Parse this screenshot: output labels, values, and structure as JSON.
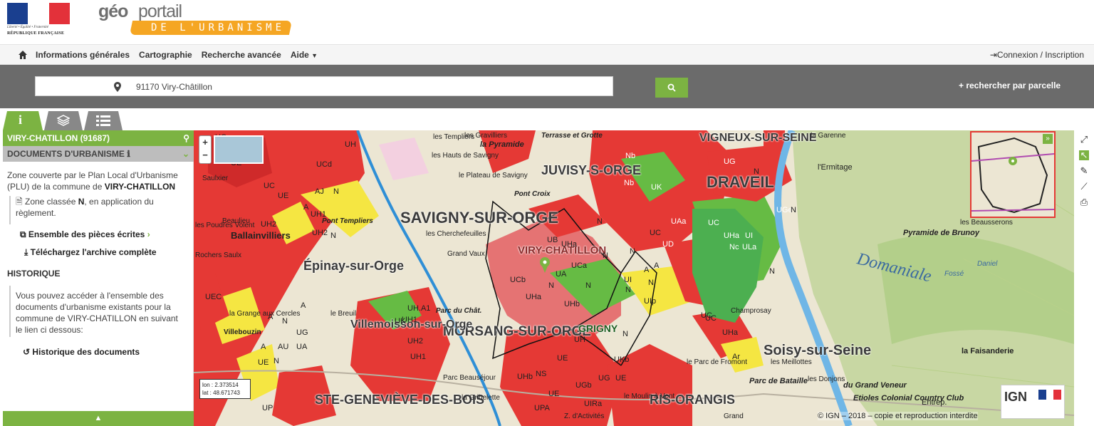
{
  "header": {
    "rf_motto": "Liberté • Égalité • Fraternité",
    "rf_name": "RÉPUBLIQUE FRANÇAISE",
    "logo_geo": "géo",
    "logo_portail": "portail",
    "logo_urbanisme": "DE L'URBANISME"
  },
  "navbar": {
    "items": [
      "Informations générales",
      "Cartographie",
      "Recherche avancée",
      "Aide"
    ],
    "login": "Connexion / Inscription"
  },
  "search": {
    "value": "91170 Viry-Châtillon",
    "parcelle": "+ rechercher par parcelle"
  },
  "panel": {
    "commune": "VIRY-CHATILLON (91687)",
    "docs_header": "DOCUMENTS D'URBANISME",
    "zone_text_1": "Zone couverte par le Plan Local d'Urbanisme (PLU) de la commune de ",
    "zone_commune": "VIRY-CHATILLON",
    "zone_classee_1": "Zone classée ",
    "zone_letter": "N",
    "zone_classee_2": ", en application du règlement.",
    "link_pieces": "Ensemble des pièces écrites",
    "link_archive": "Téléchargez l'archive complète",
    "historique": "HISTORIQUE",
    "histo_text": "Vous pouvez accéder à l'ensemble des documents d'urbanisme existants pour la commune de VIRY-CHATILLON en suivant le lien ci dessous:",
    "link_histo": "Historique des documents"
  },
  "map": {
    "lon": "lon : 2.373514",
    "lat": "lat : 48.671743",
    "copyright": "© IGN – 2018 – copie et reproduction interdite",
    "places": [
      "SAVIGNY-SUR-ORGE",
      "JUVISY-S-ORGE",
      "DRAVEIL",
      "VIGNEUX-SUR-SEINE",
      "Épinay-sur-Orge",
      "MORSANG-SUR-ORGE",
      "Villemoisson-sur-Orge",
      "VIRY-CHATILLON",
      "GRIGNY",
      "Soisy-sur-Seine",
      "STE-GENEVIÈVE-DES-BOIS",
      "RIS-ORANGIS",
      "Domaniale",
      "Pyramide de Brunoy",
      "Ballainvilliers",
      "la Pyramide",
      "Terrasse et Grotte",
      "la Garenne",
      "l'Ermitage",
      "la Faisanderie",
      "Parc de Bataille",
      "du Grand Veneur",
      "Etioles Colonial Country Club",
      "Champrosay",
      "les Templiers",
      "les Gravilliers",
      "les Hauts de Savigny",
      "le Plateau de Savigny",
      "les Cherchefeuilles",
      "Grand Vaux",
      "la Grange aux Cercles",
      "Villebouzin",
      "le Breuil",
      "Parc du Chât.",
      "Parc Beauséjour",
      "la Gribelette",
      "Z. d'Activités",
      "le Moulin à Vent",
      "les Meillottes",
      "les Donjons",
      "le Parc de Fromont",
      "Grand",
      "Entrep.",
      "Saulxier",
      "Beaulieu",
      "les Poudres Volent",
      "Rochers Saulx",
      "Pont Templiers",
      "Pont Croix",
      "les Beausserons",
      "Fossé",
      "Daniel"
    ],
    "zones": [
      "UC",
      "UH",
      "UB",
      "UE",
      "UCd",
      "UC",
      "UH2",
      "UE",
      "N",
      "A",
      "AJ",
      "UH1",
      "UH2",
      "N",
      "UEC",
      "A",
      "A",
      "N",
      "UG",
      "A",
      "AU",
      "UA",
      "N",
      "UE",
      "UH1",
      "UH2",
      "UH1",
      "UK",
      "UH.A1",
      "UCa",
      "UB",
      "UHa",
      "UA",
      "UCb",
      "N",
      "N",
      "UHa",
      "UHb",
      "UH",
      "UE",
      "UG",
      "UE",
      "NS",
      "UGb",
      "UKb",
      "UHb",
      "UPA",
      "UIRa",
      "UE",
      "Nb",
      "UG",
      "Nb",
      "UK",
      "UAa",
      "UC",
      "UGe",
      "UHa",
      "UI",
      "ULa",
      "UC",
      "UD",
      "UI",
      "UIp",
      "N",
      "A",
      "N",
      "UC",
      "UHa",
      "Ar",
      "Nc",
      "N",
      "N",
      "N",
      "N",
      "N",
      "N",
      "N",
      "A",
      "UC",
      "UP"
    ]
  },
  "colors": {
    "accent_green": "#7cb342",
    "header_gray": "#6b6b6b",
    "zone_red": "#e53935",
    "zone_green": "#66bb44",
    "zone_yellow": "#f5e642"
  }
}
